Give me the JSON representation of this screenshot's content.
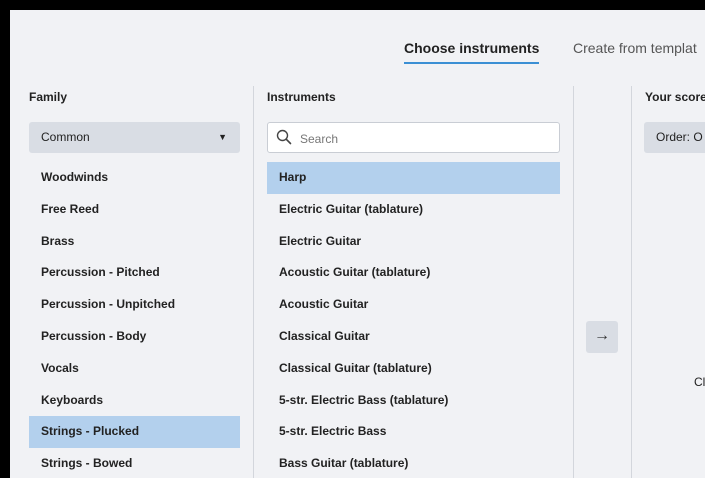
{
  "tabs": {
    "choose": "Choose instruments",
    "template": "Create from templat"
  },
  "family": {
    "title": "Family",
    "selected": "Common",
    "items": [
      "Woodwinds",
      "Free Reed",
      "Brass",
      "Percussion - Pitched",
      "Percussion - Unpitched",
      "Percussion - Body",
      "Vocals",
      "Keyboards",
      "Strings - Plucked",
      "Strings - Bowed"
    ],
    "selected_item": "Strings - Plucked"
  },
  "instruments": {
    "title": "Instruments",
    "search_placeholder": "Search",
    "items": [
      "Harp",
      "Electric Guitar (tablature)",
      "Electric Guitar",
      "Acoustic Guitar (tablature)",
      "Acoustic Guitar",
      "Classical Guitar",
      "Classical Guitar (tablature)",
      "5-str. Electric Bass (tablature)",
      "5-str. Electric Bass",
      "Bass Guitar (tablature)"
    ],
    "selected_item": "Harp"
  },
  "add_button": "→",
  "score": {
    "title": "Your score",
    "order": "Order: O",
    "partial_text": "Cl"
  },
  "colors": {
    "accent": "#3b8fd4",
    "selection": "#b3d0ed",
    "background": "#f1f2f5",
    "control": "#d9dde4"
  }
}
